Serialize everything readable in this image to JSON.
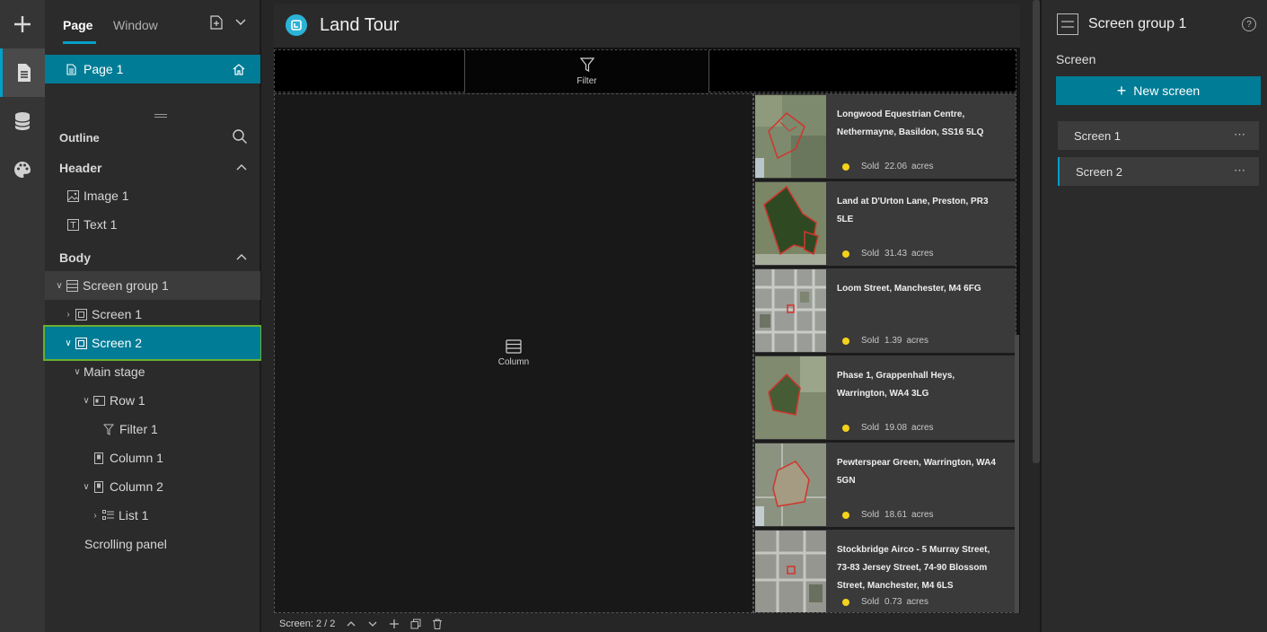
{
  "rail": {
    "icons": [
      "plus-icon",
      "page-icon",
      "data-icon",
      "palette-icon"
    ]
  },
  "left_panel": {
    "tabs": [
      {
        "label": "Page",
        "active": true
      },
      {
        "label": "Window",
        "active": false
      }
    ],
    "page_item": {
      "label": "Page 1"
    },
    "outline_label": "Outline",
    "header_section": "Header",
    "header_items": [
      "Image 1",
      "Text 1"
    ],
    "body_section": "Body",
    "tree": {
      "screen_group": "Screen group 1",
      "screen1": "Screen 1",
      "screen2": "Screen 2",
      "main_stage": "Main stage",
      "row1": "Row 1",
      "filter1": "Filter 1",
      "column1": "Column 1",
      "column2": "Column 2",
      "list1": "List 1",
      "scrolling_panel": "Scrolling panel"
    }
  },
  "preview": {
    "app_title": "Land Tour",
    "filter_label": "Filter",
    "column_label": "Column",
    "cards": [
      {
        "address": "Longwood Equestrian Centre, Nethermayne, Basildon, SS16 5LQ",
        "status": "Sold",
        "value": "22.06",
        "unit": "acres"
      },
      {
        "address": "Land at D'Urton Lane, Preston, PR3 5LE",
        "status": "Sold",
        "value": "31.43",
        "unit": "acres"
      },
      {
        "address": "Loom Street, Manchester, M4 6FG",
        "status": "Sold",
        "value": "1.39",
        "unit": "acres"
      },
      {
        "address": "Phase 1, Grappenhall Heys, Warrington, WA4 3LG",
        "status": "Sold",
        "value": "19.08",
        "unit": "acres"
      },
      {
        "address": "Pewterspear Green, Warrington, WA4 5GN",
        "status": "Sold",
        "value": "18.61",
        "unit": "acres"
      },
      {
        "address": "Stockbridge Airco - 5 Murray Street, 73-83 Jersey Street, 74-90 Blossom Street, Manchester, M4 6LS",
        "status": "Sold",
        "value": "0.73",
        "unit": "acres"
      }
    ],
    "screen_indicator": "Screen: 2 / 2"
  },
  "right_panel": {
    "title": "Screen group 1",
    "help": "?",
    "section_label": "Screen",
    "new_button": "New screen",
    "screens": [
      {
        "label": "Screen 1",
        "active": false
      },
      {
        "label": "Screen 2",
        "active": true
      }
    ],
    "more": "⋯"
  },
  "colors": {
    "accent": "#007c96",
    "highlight": "#00a0c8",
    "selection_outline": "#6ab030",
    "status_dot": "#f5d21b"
  }
}
